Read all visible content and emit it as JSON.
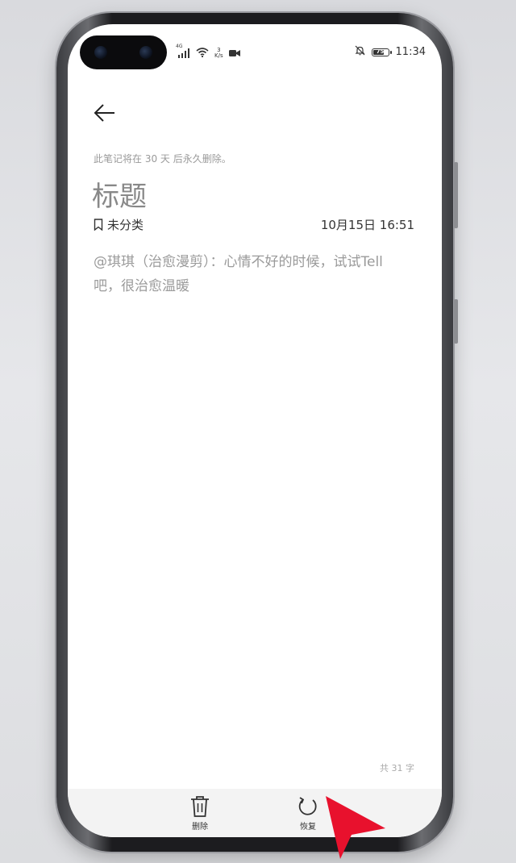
{
  "status_bar": {
    "network_type": "4G",
    "net_speed_value": "3",
    "net_speed_unit": "K/s",
    "battery_label": "75",
    "battery_level": 0.75,
    "time": "11:34"
  },
  "note": {
    "deletion_notice": "此笔记将在 30 天 后永久删除。",
    "title": "标题",
    "category": "未分类",
    "timestamp": "10月15日 16:51",
    "content": "@琪琪（治愈漫剪）：心情不好的时候，试试Tell吧，很治愈温暖",
    "word_count": "共 31 字"
  },
  "actions": {
    "delete_label": "删除",
    "restore_label": "恢复"
  },
  "colors": {
    "pointer_arrow": "#e8112d",
    "accent_text": "#333333",
    "muted_text": "#9a9a9a"
  },
  "icons": {
    "back": "arrow-left-icon",
    "category": "bookmark-icon",
    "delete": "trash-icon",
    "restore": "refresh-icon",
    "video": "video-camera-icon",
    "mute": "bell-off-icon"
  }
}
